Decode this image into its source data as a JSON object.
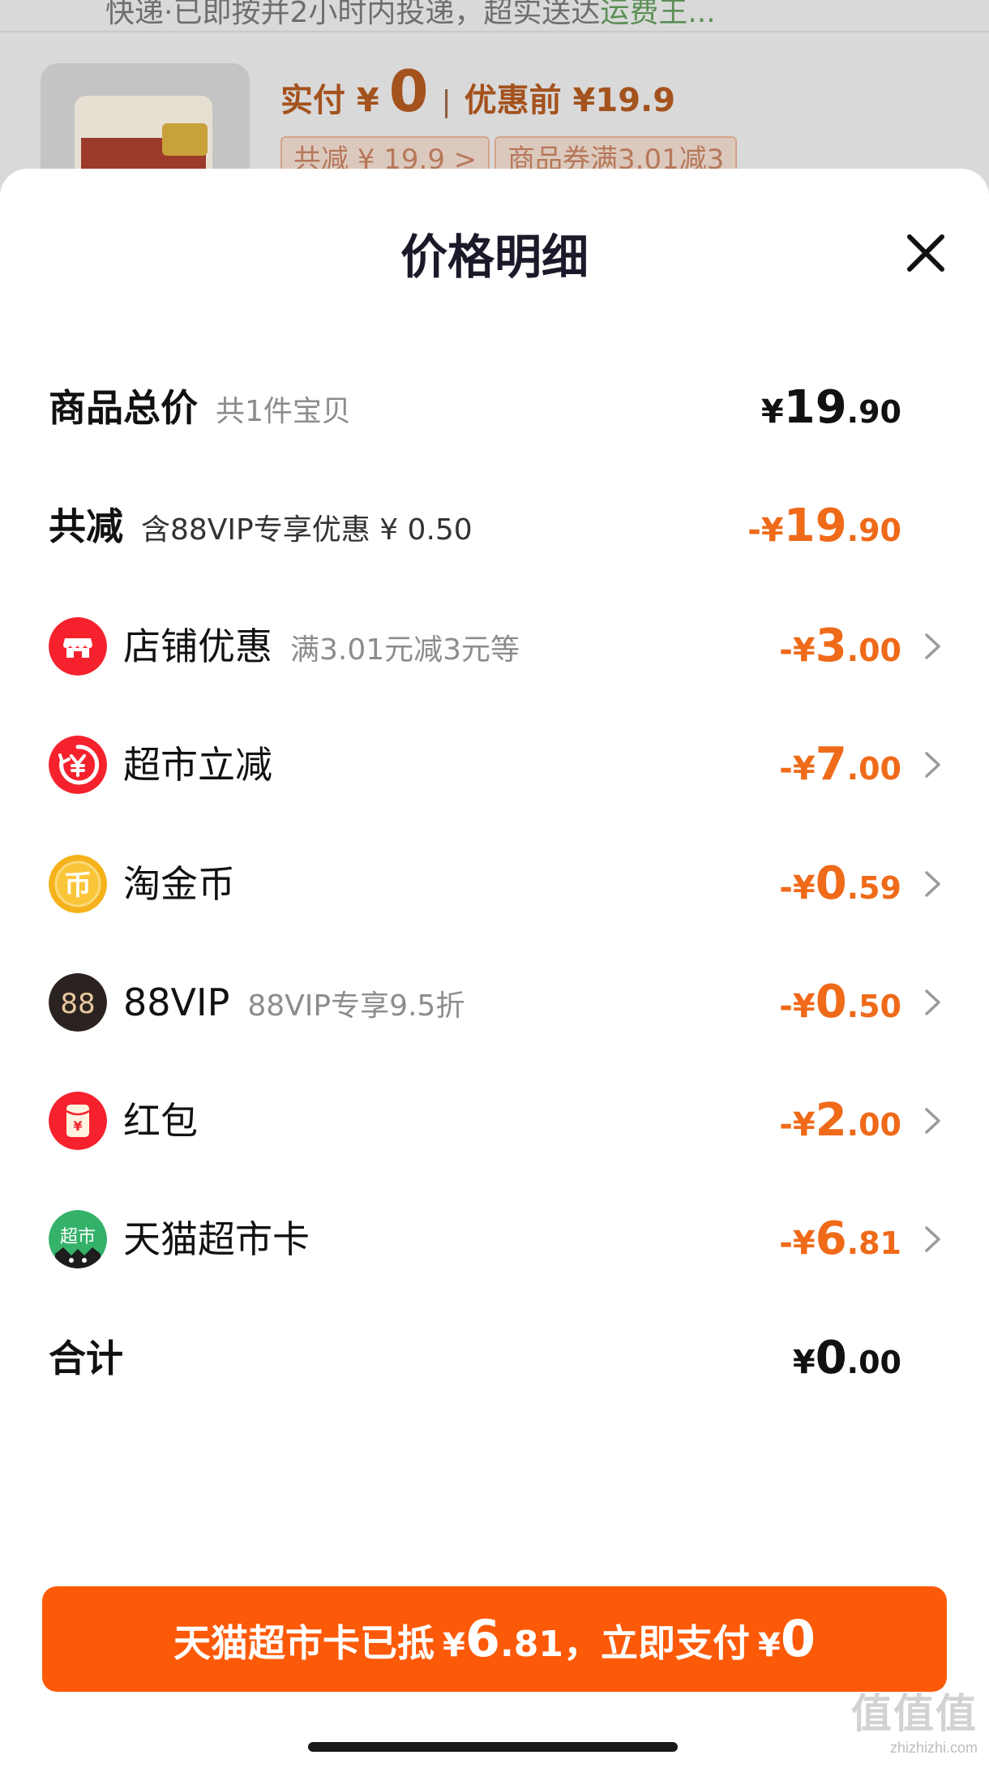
{
  "background": {
    "hint_text": "快递·已即按并2小时内投递，超实送达",
    "hint_link": "运费王...",
    "paid_label": "实付 ¥",
    "paid_value": "0",
    "before_label": "优惠前 ¥19.9",
    "chip_total_discount": "共减 ¥ 19.9 >",
    "chip_coupon": "商品券满3.01减3"
  },
  "sheet": {
    "title": "价格明细",
    "rows": {
      "total": {
        "label": "商品总价",
        "sub": "共1件宝贝",
        "currency": "¥",
        "int": "19",
        "dec": ".90"
      },
      "discount": {
        "label": "共减",
        "sub": "含88VIP专享优惠 ¥ 0.50",
        "currency": "-¥",
        "int": "19",
        "dec": ".90"
      },
      "shop": {
        "icon": "shop-icon",
        "label": "店铺优惠",
        "sub": "满3.01元减3元等",
        "currency": "-¥",
        "int": "3",
        "dec": ".00"
      },
      "supermarket": {
        "icon": "yuan-coin-icon",
        "label": "超市立减",
        "currency": "-¥",
        "int": "7",
        "dec": ".00"
      },
      "gold_coin": {
        "icon": "gold-coin-icon",
        "icon_text": "币",
        "label": "淘金币",
        "currency": "-¥",
        "int": "0",
        "dec": ".59"
      },
      "vip": {
        "icon": "88vip-icon",
        "icon_text": "88",
        "label": "88VIP",
        "sub": "88VIP专享9.5折",
        "currency": "-¥",
        "int": "0",
        "dec": ".50"
      },
      "red_packet": {
        "icon": "red-packet-icon",
        "icon_text": "¥",
        "label": "红包",
        "currency": "-¥",
        "int": "2",
        "dec": ".00"
      },
      "tmall_card": {
        "icon": "tmall-supermarket-card-icon",
        "icon_text": "超市",
        "label": "天猫超市卡",
        "currency": "-¥",
        "int": "6",
        "dec": ".81"
      },
      "sum": {
        "label": "合计",
        "currency": "¥",
        "int": "0",
        "dec": ".00"
      }
    }
  },
  "pay_button": {
    "text": "天猫超市卡已抵",
    "card_currency": "¥",
    "card_int": "6",
    "card_dec": ".81",
    "middle": "，立即支付",
    "pay_currency": "¥",
    "pay_int": "0"
  },
  "watermark": {
    "logo": "值值值",
    "url": "zhizhizhi.com"
  },
  "colors": {
    "accent_orange": "#ef6a19",
    "button_orange": "#fc5a08",
    "text_dark": "#111111",
    "text_gray": "#8c8c8c"
  }
}
